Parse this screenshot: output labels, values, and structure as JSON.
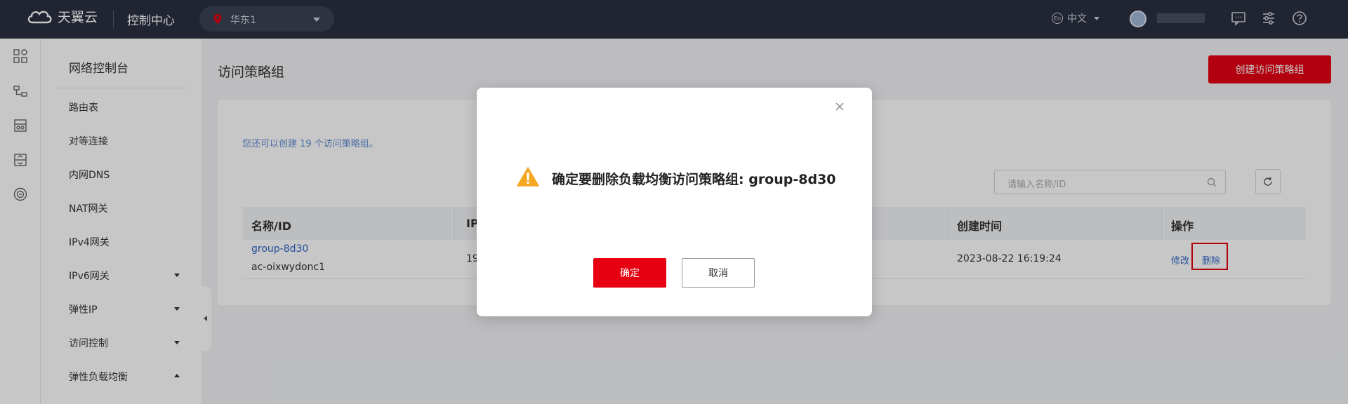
{
  "topbar": {
    "brand": "天翼云",
    "console_title": "控制中心",
    "region": "华东1",
    "language": "中文",
    "language_badge": "En"
  },
  "sidebar": {
    "title": "网络控制台",
    "items": [
      {
        "label": "路由表"
      },
      {
        "label": "对等连接"
      },
      {
        "label": "内网DNS"
      },
      {
        "label": "NAT网关"
      },
      {
        "label": "IPv4网关"
      },
      {
        "label": "IPv6网关"
      },
      {
        "label": "弹性IP"
      },
      {
        "label": "访问控制"
      },
      {
        "label": "弹性负载均衡"
      }
    ]
  },
  "main": {
    "page_title": "访问策略组",
    "create_button": "创建访问策略组",
    "hint": "您还可以创建 19 个访问策略组。",
    "search_placeholder": "请输入名称/ID",
    "table": {
      "headers": [
        "名称/ID",
        "IP",
        "创建时间",
        "操作"
      ],
      "rows": [
        {
          "name": "group-8d30",
          "id": "ac-oixwydonc1",
          "ip": "19",
          "created": "2023-08-22 16:19:24",
          "action_edit": "修改",
          "action_delete": "删除"
        }
      ]
    }
  },
  "modal": {
    "message": "确定要删除负载均衡访问策略组: group-8d30",
    "confirm": "确定",
    "cancel": "取消"
  },
  "colors": {
    "accent": "#e60012",
    "topbar": "#2b3040",
    "link": "#2d64c8"
  }
}
